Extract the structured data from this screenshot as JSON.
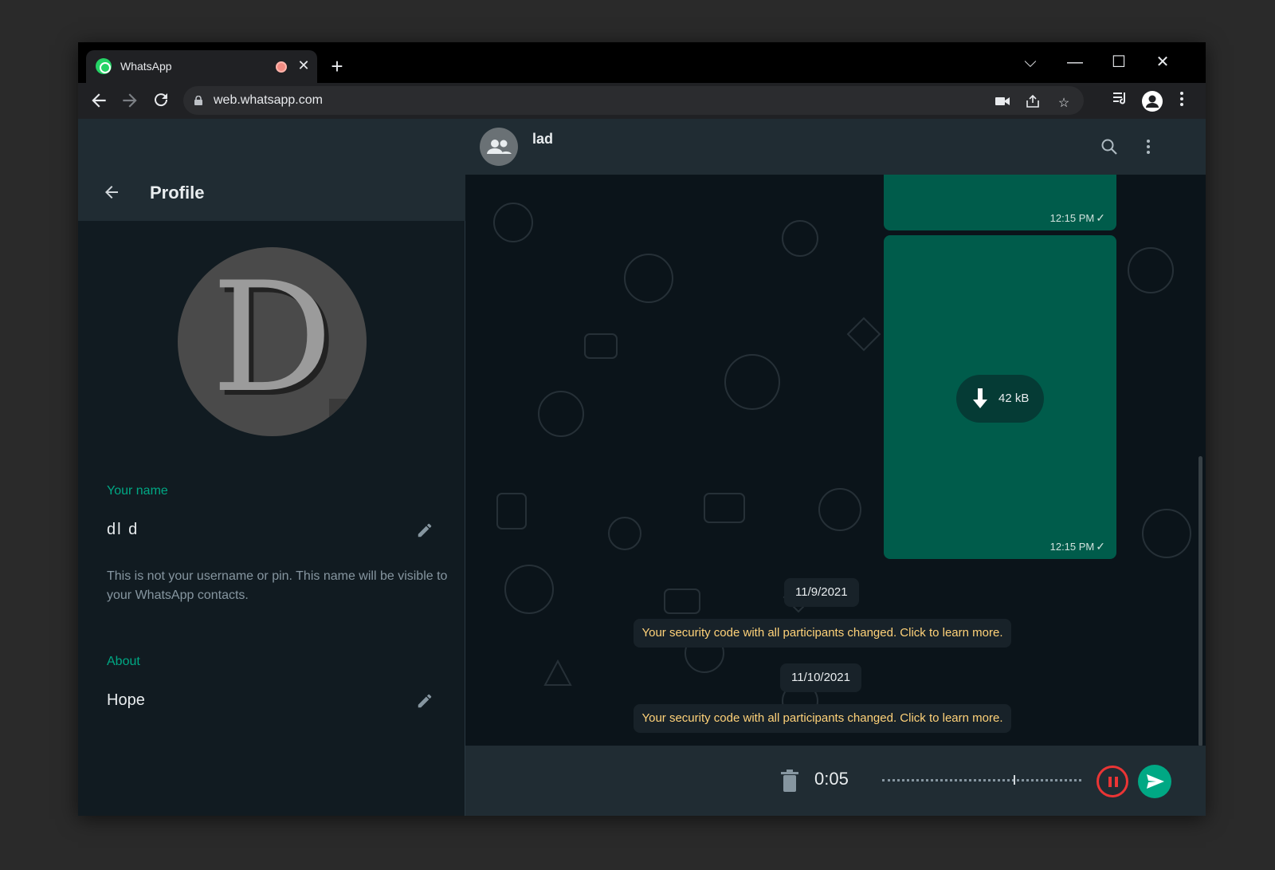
{
  "browser": {
    "tab_title": "WhatsApp",
    "url": "web.whatsapp.com",
    "new_tab_symbol": "+",
    "window_controls": {
      "dropdown": "⌵",
      "minimize": "—",
      "maximize": "☐",
      "close": "✕"
    }
  },
  "profile_panel": {
    "title": "Profile",
    "avatar_letter": "D",
    "name_label": "Your name",
    "name_value": "dl d",
    "name_helper": "This is not your username or pin. This name will be visible to your WhatsApp contacts.",
    "about_label": "About",
    "about_value": "Hope"
  },
  "chat": {
    "name": "lad",
    "messages": [
      {
        "type": "image",
        "time": "12:15 PM"
      },
      {
        "type": "image",
        "time": "12:15 PM",
        "download_size": "42 kB"
      }
    ],
    "events": [
      {
        "date": "11/9/2021",
        "system_text": "Your security code with all participants changed. Click to learn more."
      },
      {
        "date": "11/10/2021",
        "system_text": "Your security code with all participants changed. Click to learn more."
      }
    ],
    "recording": {
      "elapsed": "0:05"
    }
  },
  "colors": {
    "accent": "#00a884",
    "outgoing_bubble": "#005c4b",
    "system_text": "#ffd279",
    "pause_red": "#ea3535",
    "panel_bg": "#111b21",
    "header_bg": "#202c33"
  },
  "icons": [
    "whatsapp-icon",
    "record-indicator-icon",
    "close-icon",
    "back-icon",
    "forward-icon",
    "reload-icon",
    "lock-icon",
    "camera-icon",
    "share-icon",
    "star-icon",
    "media-icon",
    "profile-icon",
    "more-icon",
    "arrow-left-icon",
    "pencil-icon",
    "group-icon",
    "search-icon",
    "download-icon",
    "trash-icon",
    "pause-icon",
    "send-icon"
  ]
}
